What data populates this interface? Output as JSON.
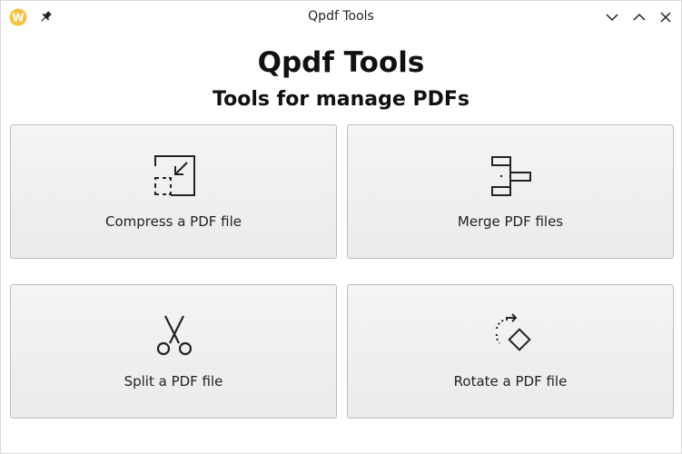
{
  "window": {
    "title": "Qpdf Tools",
    "app_icon_letter": "W",
    "accent": "#f5c242"
  },
  "header": {
    "title": "Qpdf Tools",
    "subtitle": "Tools for manage PDFs"
  },
  "tools": [
    {
      "label": "Compress a PDF file",
      "icon": "compress-icon"
    },
    {
      "label": "Merge PDF files",
      "icon": "merge-icon"
    },
    {
      "label": "Split a PDF file",
      "icon": "scissors-icon"
    },
    {
      "label": "Rotate a PDF file",
      "icon": "rotate-icon"
    }
  ]
}
